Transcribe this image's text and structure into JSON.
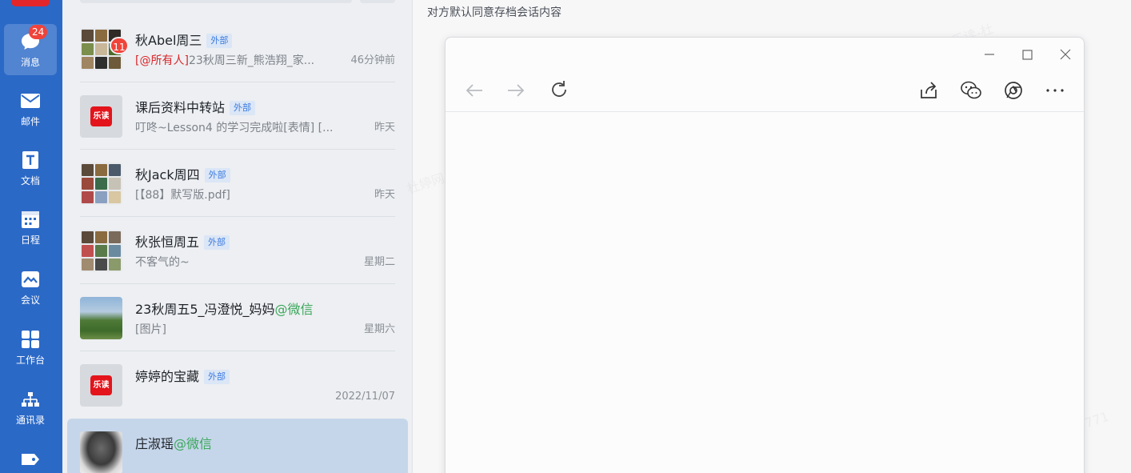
{
  "sidebar": {
    "items": [
      {
        "label": "消息",
        "badge": "24"
      },
      {
        "label": "邮件"
      },
      {
        "label": "文档"
      },
      {
        "label": "日程"
      },
      {
        "label": "会议"
      },
      {
        "label": "工作台"
      },
      {
        "label": "通讯录"
      }
    ]
  },
  "conversations": [
    {
      "name": "秋Abel周三",
      "tag": "外部",
      "unread": "11",
      "mention": "[@所有人]",
      "preview": "23秋周三新_熊浩翔_家...",
      "time": "46分钟前"
    },
    {
      "name": "课后资料中转站",
      "tag": "外部",
      "logo": "乐读",
      "preview": "叮咚~Lesson4 的学习完成啦[表情]  [...",
      "time": "昨天"
    },
    {
      "name": "秋Jack周四",
      "tag": "外部",
      "preview": "[【88】默写版.pdf]",
      "time": "昨天"
    },
    {
      "name": "秋张恒周五",
      "tag": "外部",
      "preview": "不客气的~",
      "time": "星期二"
    },
    {
      "name": "23秋周五5_冯澄悦_妈妈",
      "suffix": "@微信",
      "preview": "[图片]",
      "time": "星期六"
    },
    {
      "name": "婷婷的宝藏",
      "tag": "外部",
      "logo": "乐读",
      "preview": "",
      "time": "2022/11/07"
    },
    {
      "name": "庄淑瑶",
      "suffix": "@微信",
      "preview": "",
      "time": ""
    }
  ],
  "chat": {
    "notice": "对方默认同意存档会话内容",
    "watermarks": [
      "杜婷网@乐读-杜",
      "杜婷网@乐读-杜",
      "771"
    ]
  },
  "colors": {
    "rail": "#2b69c7",
    "badge": "#f0433a",
    "tag_text": "#3b7be0",
    "wechat": "#3aa75a",
    "mention": "#d7262b"
  }
}
